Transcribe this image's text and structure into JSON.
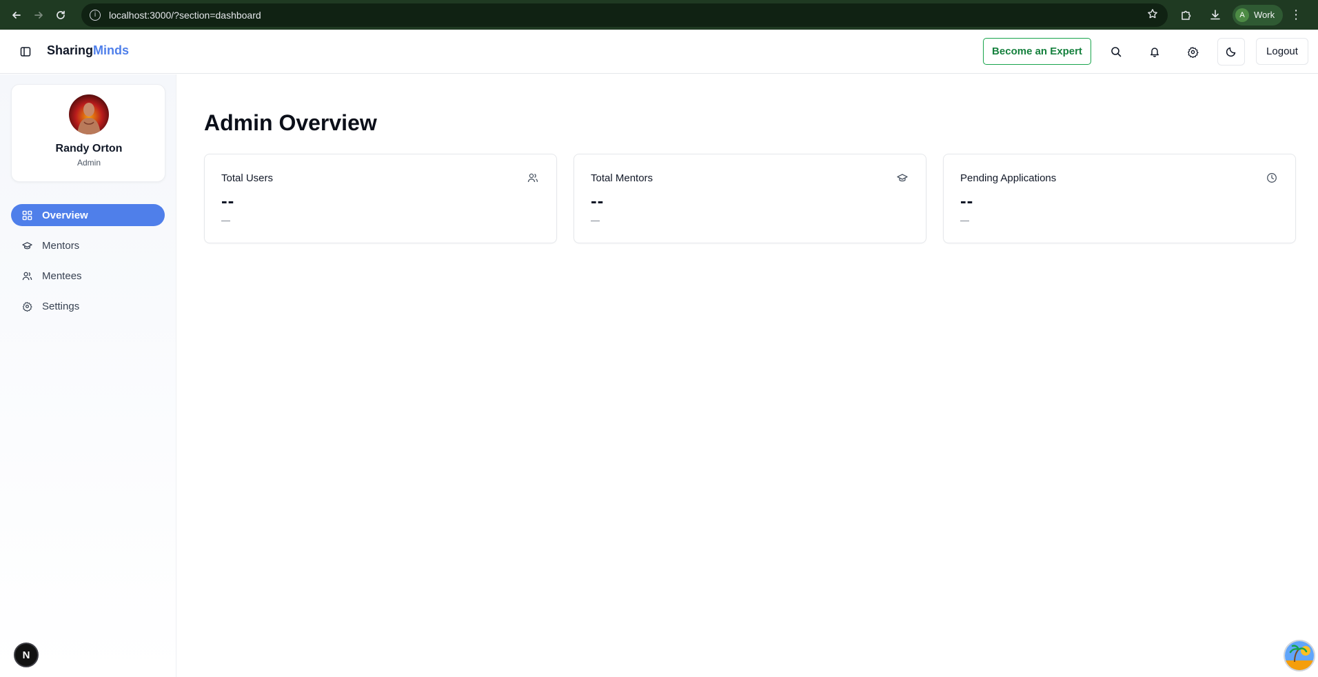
{
  "browser": {
    "url": "localhost:3000/?section=dashboard",
    "profile_initial": "A",
    "profile_label": "Work"
  },
  "header": {
    "brand_part1": "Sharing",
    "brand_part2": "Minds",
    "become_expert_label": "Become an Expert",
    "logout_label": "Logout"
  },
  "sidebar": {
    "user_name": "Randy Orton",
    "user_role": "Admin",
    "items": [
      {
        "label": "Overview",
        "icon": "layout-grid-icon",
        "active": true
      },
      {
        "label": "Mentors",
        "icon": "graduation-cap-icon",
        "active": false
      },
      {
        "label": "Mentees",
        "icon": "users-icon",
        "active": false
      },
      {
        "label": "Settings",
        "icon": "gear-icon",
        "active": false
      }
    ],
    "next_badge": "N"
  },
  "main": {
    "title": "Admin Overview",
    "cards": [
      {
        "title": "Total Users",
        "icon": "users-icon",
        "value": "--",
        "sub": "—"
      },
      {
        "title": "Total Mentors",
        "icon": "graduation-cap-icon",
        "value": "--",
        "sub": "—"
      },
      {
        "title": "Pending Applications",
        "icon": "clock-icon",
        "value": "--",
        "sub": "—"
      }
    ]
  },
  "colors": {
    "accent": "#4f7fea",
    "expert_green": "#16a34a",
    "chrome_bg": "#1f3a22"
  }
}
